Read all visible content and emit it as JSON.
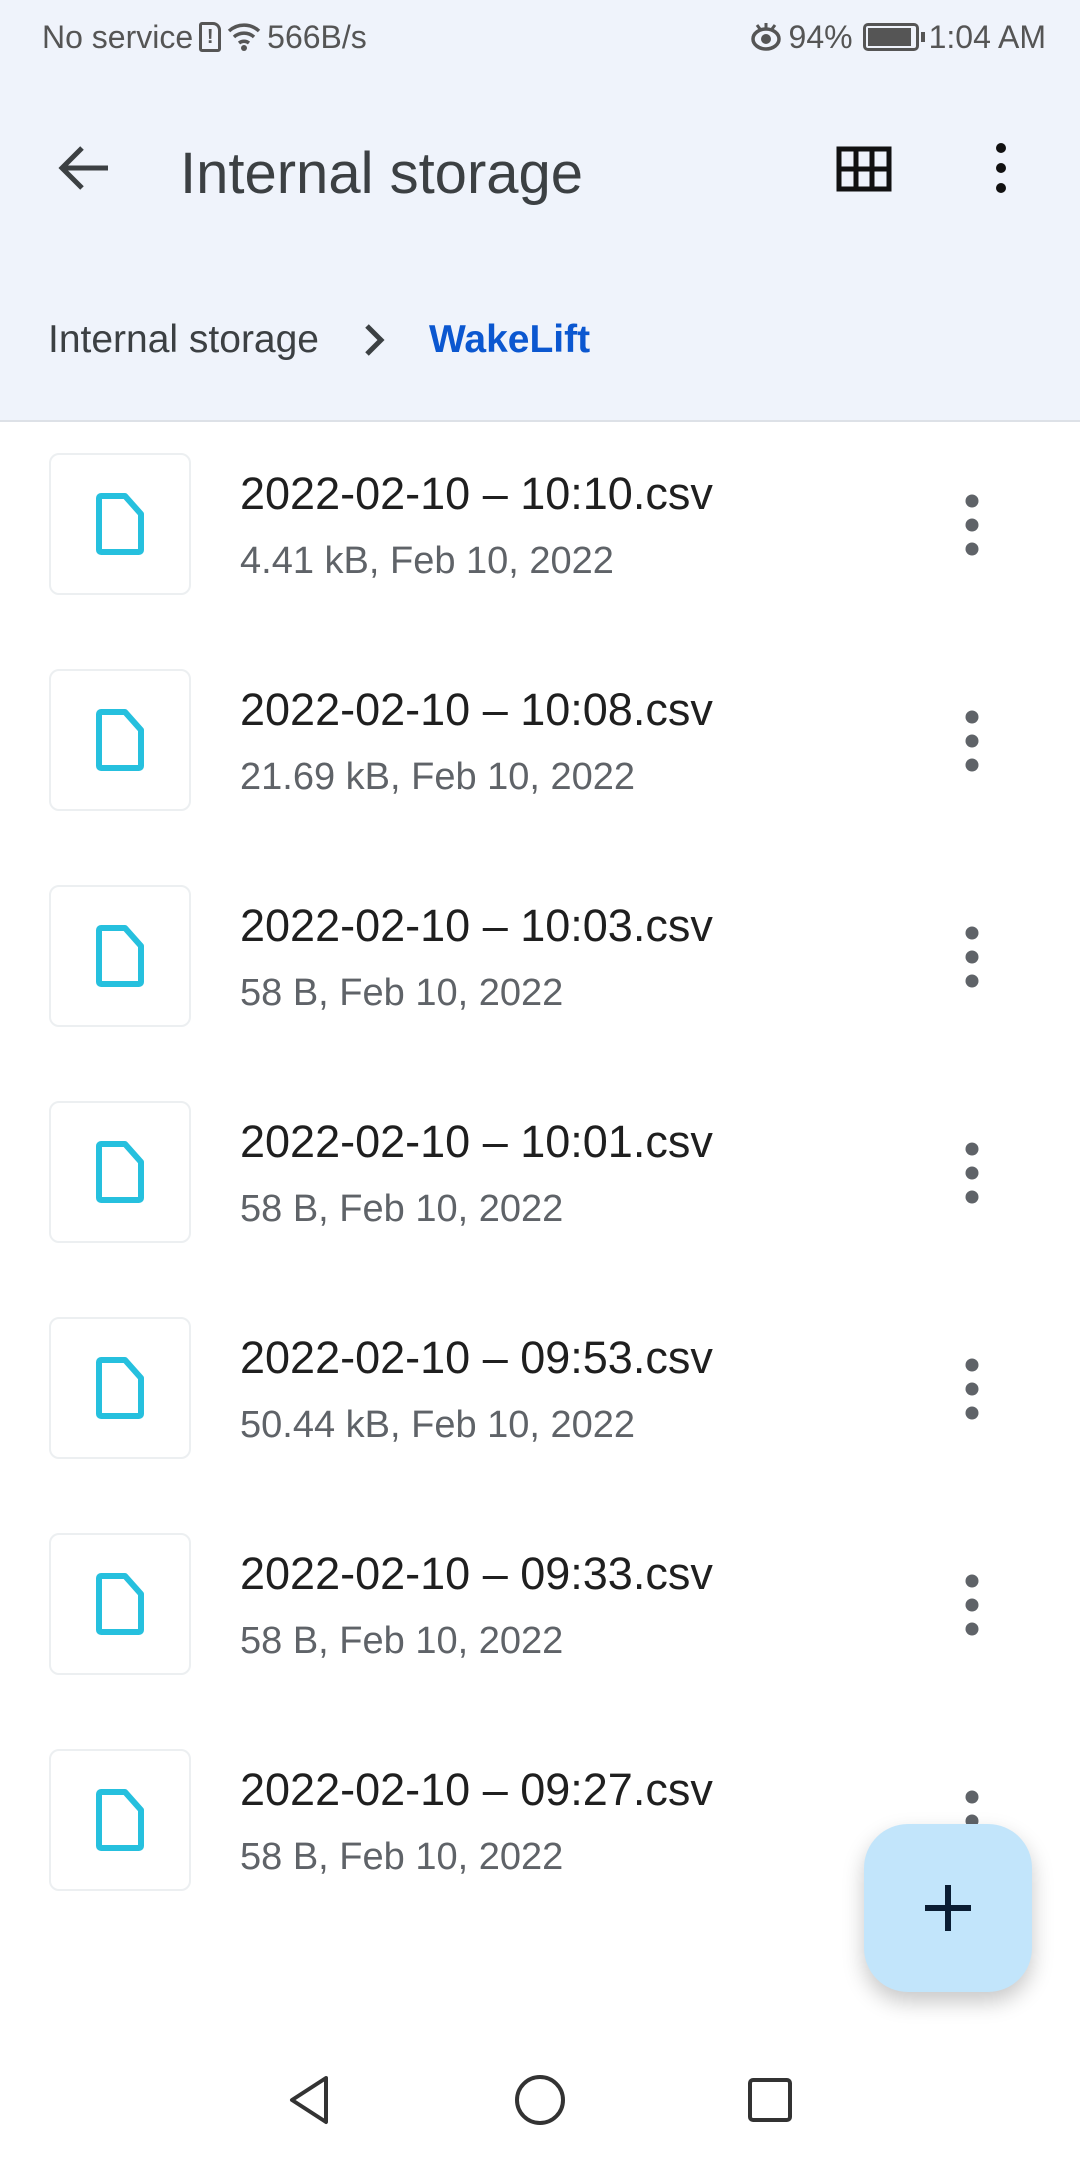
{
  "status_bar": {
    "carrier": "No service",
    "net_speed": "566B/s",
    "battery": "94%",
    "battery_level": 94,
    "time": "1:04 AM"
  },
  "toolbar": {
    "title": "Internal storage"
  },
  "breadcrumb": {
    "items": [
      "Internal storage",
      "WakeLift"
    ]
  },
  "files": [
    {
      "name": "2022-02-10 – 10:10.csv",
      "meta": "4.41 kB, Feb 10, 2022"
    },
    {
      "name": "2022-02-10 – 10:08.csv",
      "meta": "21.69 kB, Feb 10, 2022"
    },
    {
      "name": "2022-02-10 – 10:03.csv",
      "meta": "58 B, Feb 10, 2022"
    },
    {
      "name": "2022-02-10 – 10:01.csv",
      "meta": "58 B, Feb 10, 2022"
    },
    {
      "name": "2022-02-10 – 09:53.csv",
      "meta": "50.44 kB, Feb 10, 2022"
    },
    {
      "name": "2022-02-10 – 09:33.csv",
      "meta": "58 B, Feb 10, 2022"
    },
    {
      "name": "2022-02-10 – 09:27.csv",
      "meta": "58 B, Feb 10, 2022"
    }
  ],
  "colors": {
    "accent": "#0b57d0",
    "file_icon": "#26c0de",
    "fab": "#c2e5fb",
    "header_bg": "#eff3fb"
  }
}
